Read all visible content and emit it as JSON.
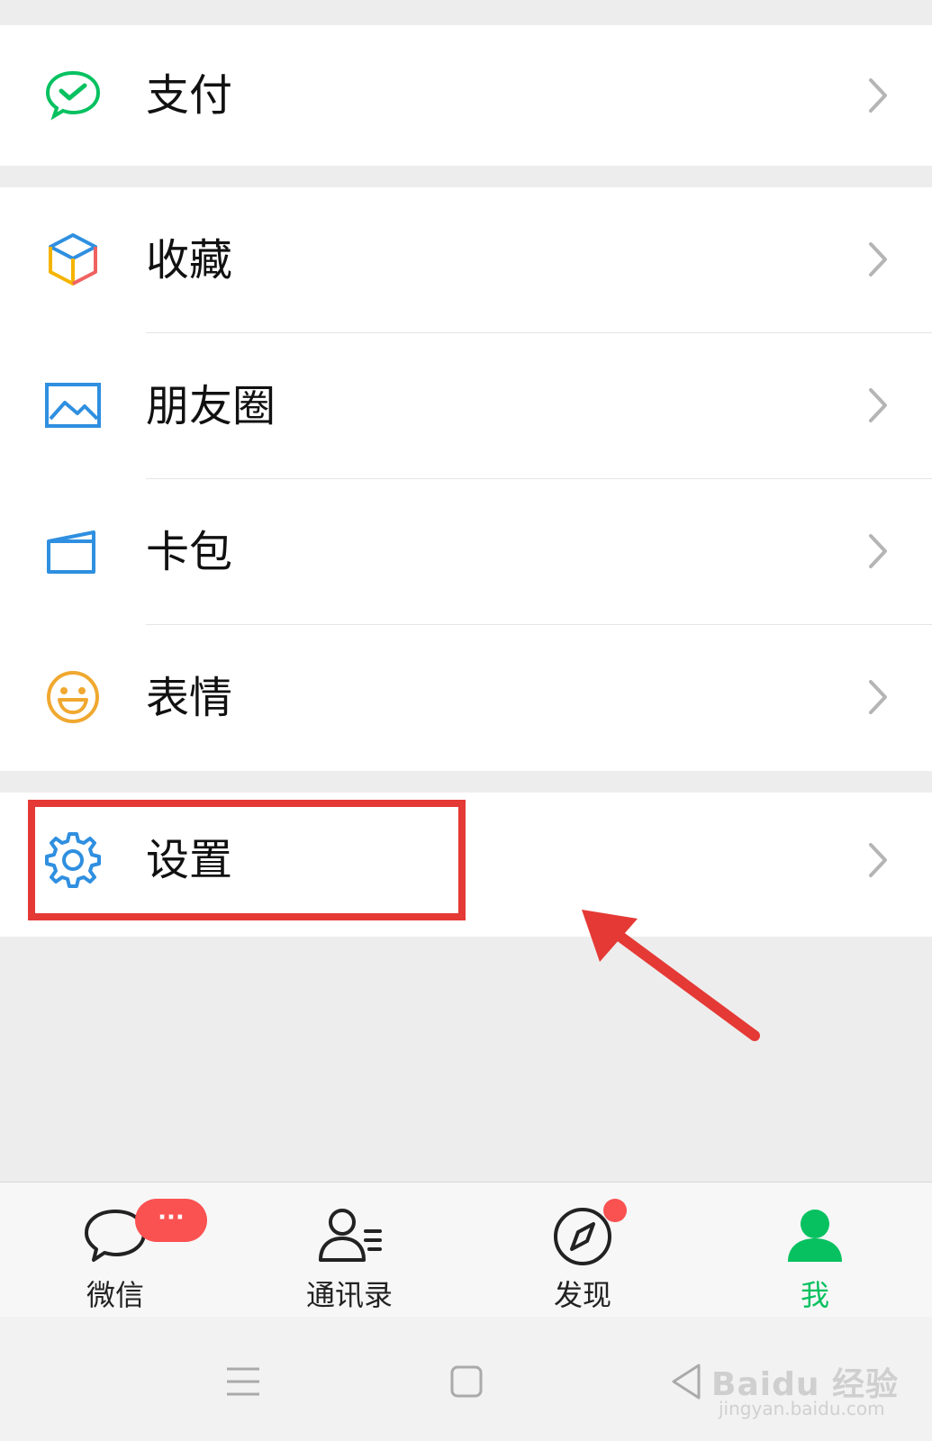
{
  "menu": {
    "pay": {
      "label": "支付",
      "icon": "wechat-pay-icon"
    },
    "favorites": {
      "label": "收藏",
      "icon": "cube-icon"
    },
    "moments": {
      "label": "朋友圈",
      "icon": "image-icon"
    },
    "cards": {
      "label": "卡包",
      "icon": "card-icon"
    },
    "stickers": {
      "label": "表情",
      "icon": "smiley-icon"
    },
    "settings": {
      "label": "设置",
      "icon": "gear-icon"
    }
  },
  "tabbar": {
    "chats": {
      "label": "微信",
      "badge": "···"
    },
    "contacts": {
      "label": "通讯录"
    },
    "discover": {
      "label": "发现"
    },
    "me": {
      "label": "我"
    }
  },
  "watermark": {
    "brand": "Baidu 经验",
    "url": "jingyan.baidu.com"
  },
  "colors": {
    "accent": "#07c160",
    "badge": "#fa5151",
    "annotation": "#e53935",
    "icon_blue": "#2f8fe0"
  }
}
